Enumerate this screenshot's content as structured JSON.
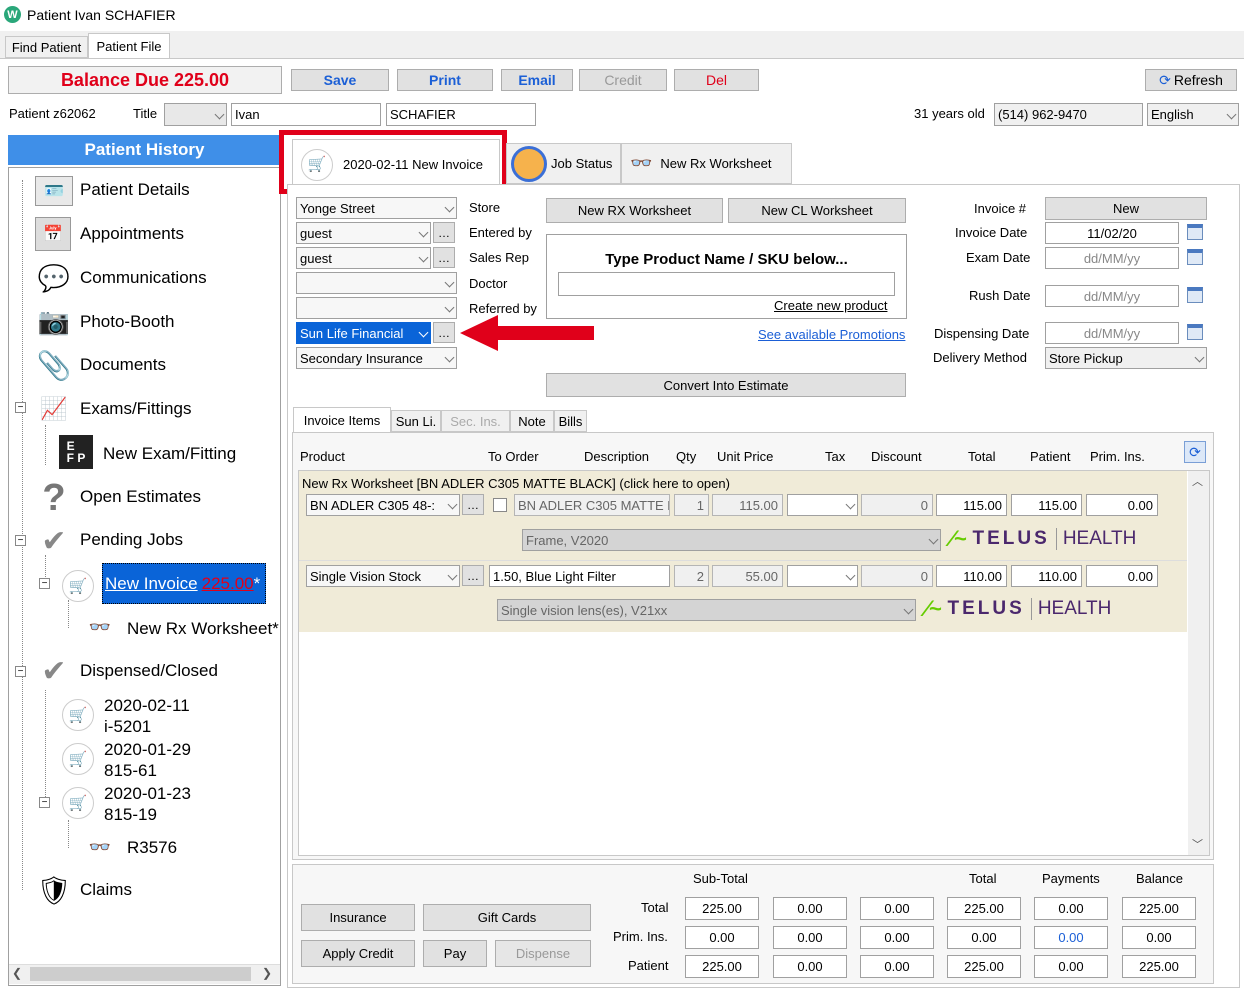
{
  "window": {
    "title": "Patient Ivan SCHAFIER"
  },
  "top_tabs": [
    "Find Patient",
    "Patient File"
  ],
  "toolbar": {
    "balance_due": "Balance Due 225.00",
    "save": "Save",
    "print": "Print",
    "email": "Email",
    "credit": "Credit",
    "del": "Del",
    "refresh": "Refresh"
  },
  "patient": {
    "id_label": "Patient z62062",
    "title_label": "Title",
    "first_name": "Ivan",
    "last_name": "SCHAFIER",
    "age": "31 years old",
    "phone": "(514) 962-9470",
    "language": "English"
  },
  "history": {
    "header": "Patient History",
    "items": {
      "details": "Patient Details",
      "appointments": "Appointments",
      "communications": "Communications",
      "photo_booth": "Photo-Booth",
      "documents": "Documents",
      "exams": "Exams/Fittings",
      "new_exam": "New Exam/Fitting",
      "open_estimates": "Open Estimates",
      "pending_jobs": "Pending Jobs",
      "new_invoice": "New Invoice",
      "new_invoice_amount": "225.00",
      "new_invoice_star": "*",
      "new_rx": "New Rx Worksheet*",
      "dispensed": "Dispensed/Closed",
      "inv1_date": "2020-02-11",
      "inv1_id": "i-5201",
      "inv2_date": "2020-01-29",
      "inv2_id": "815-61",
      "inv3_date": "2020-01-23",
      "inv3_id": "815-19",
      "rx": "R3576",
      "claims": "Claims"
    }
  },
  "doc_tabs": [
    "2020-02-11 New Invoice",
    "Job Status",
    "New Rx Worksheet"
  ],
  "invoice": {
    "store": "Yonge Street",
    "entered_by": "guest",
    "sales_rep": "guest",
    "doctor": "",
    "referred_by": "",
    "insurance": "Sun Life Financial",
    "secondary": "Secondary Insurance",
    "labels": {
      "store": "Store",
      "entered_by": "Entered by",
      "sales_rep": "Sales Rep",
      "doctor": "Doctor",
      "referred_by": "Referred by"
    },
    "new_rx": "New RX Worksheet",
    "new_cl": "New CL Worksheet",
    "product_prompt": "Type Product Name / SKU below...",
    "create_product": "Create new product",
    "promotions": "See available Promotions",
    "convert": "Convert Into Estimate",
    "invoice_no_label": "Invoice #",
    "invoice_no": "New",
    "invoice_date_label": "Invoice Date",
    "invoice_date": "11/02/20",
    "exam_date_label": "Exam Date",
    "exam_date": "dd/MM/yy",
    "rush_date_label": "Rush Date",
    "rush_date": "dd/MM/yy",
    "dispensing_label": "Dispensing Date",
    "dispensing_date": "dd/MM/yy",
    "delivery_label": "Delivery Method",
    "delivery": "Store Pickup"
  },
  "item_tabs": [
    "Invoice Items",
    "Sun Li.",
    "Sec. Ins.",
    "Note",
    "Bills"
  ],
  "columns": [
    "Product",
    "To Order",
    "Description",
    "Qty",
    "Unit Price",
    "Tax",
    "Discount",
    "Total",
    "Patient",
    "Prim. Ins."
  ],
  "group_title": "New Rx Worksheet [BN ADLER C305 MATTE BLACK] (click here to open)",
  "rows": [
    {
      "product": "BN ADLER C305  48-:",
      "description": "BN ADLER C305 MATTE B",
      "qty": "1",
      "unit_price": "115.00",
      "discount": "0",
      "total": "115.00",
      "patient": "115.00",
      "prim": "0.00",
      "sub": "Frame, V2020"
    },
    {
      "product": "Single Vision Stock",
      "description": "1.50, Blue Light Filter",
      "qty": "2",
      "unit_price": "55.00",
      "discount": "0",
      "total": "110.00",
      "patient": "110.00",
      "prim": "0.00",
      "sub": "Single vision lens(es), V21xx"
    }
  ],
  "telus": {
    "word": "TELUS",
    "health": "HEALTH"
  },
  "totals": {
    "headers": {
      "subtotal": "Sub-Total",
      "total": "Total",
      "payments": "Payments",
      "balance": "Balance"
    },
    "row_labels": [
      "Total",
      "Prim. Ins.",
      "Patient"
    ],
    "rows": [
      [
        "225.00",
        "0.00",
        "0.00",
        "225.00",
        "0.00",
        "225.00"
      ],
      [
        "0.00",
        "0.00",
        "0.00",
        "0.00",
        "0.00",
        "0.00"
      ],
      [
        "225.00",
        "0.00",
        "0.00",
        "225.00",
        "0.00",
        "225.00"
      ]
    ]
  },
  "bottom_buttons": {
    "insurance": "Insurance",
    "gift_cards": "Gift Cards",
    "apply_credit": "Apply Credit",
    "pay": "Pay",
    "dispense": "Dispense"
  },
  "colors": {
    "accent_blue": "#1b5fd6",
    "highlight_red": "#e0001a",
    "history_header": "#3f8fe8"
  }
}
